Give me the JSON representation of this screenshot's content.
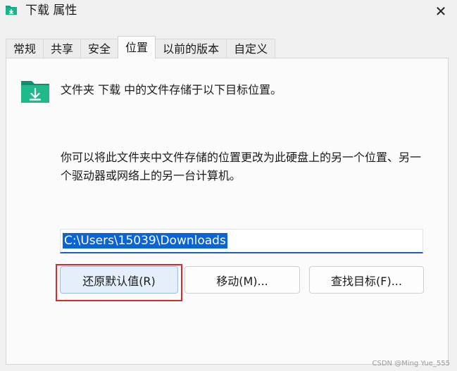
{
  "window": {
    "title": "下载 属性",
    "close_glyph": "✕",
    "icon": "download-folder-icon"
  },
  "tabs": [
    {
      "label": "常规",
      "active": false
    },
    {
      "label": "共享",
      "active": false
    },
    {
      "label": "安全",
      "active": false
    },
    {
      "label": "位置",
      "active": true
    },
    {
      "label": "以前的版本",
      "active": false
    },
    {
      "label": "自定义",
      "active": false
    }
  ],
  "location": {
    "folder_icon": "download-folder-icon",
    "info_text": "文件夹 下载 中的文件存储于以下目标位置。",
    "description": "你可以将此文件夹中文件存储的位置更改为此硬盘上的另一个位置、另一个驱动器或网络上的另一台计算机。",
    "path_value": "C:\\Users\\15039\\Downloads"
  },
  "buttons": {
    "restore_default": "还原默认值(R)",
    "move": "移动(M)...",
    "find_target": "查找目标(F)..."
  },
  "watermark": "CSDN @Ming Yue_555",
  "colors": {
    "accent": "#0a64d6",
    "highlight_border": "#d62b2b",
    "folder_green": "#17a07a"
  }
}
